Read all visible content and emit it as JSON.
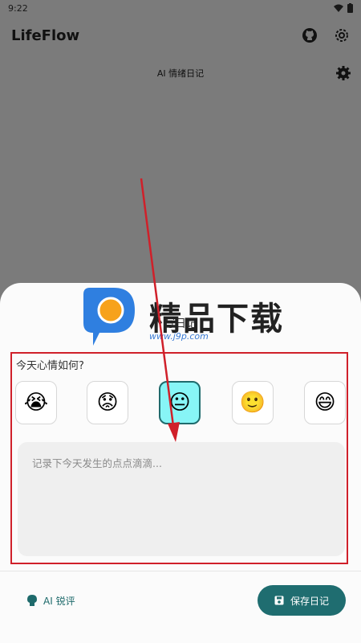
{
  "status": {
    "time": "9:22"
  },
  "app": {
    "title": "LifeFlow"
  },
  "diary_page": {
    "title": "AI 情绪日记"
  },
  "sheet": {
    "title": "写日记",
    "question": "今天心情如何?",
    "moods": [
      {
        "emoji": "😭",
        "selected": false
      },
      {
        "emoji": "😟",
        "selected": false
      },
      {
        "emoji": "😐",
        "selected": true
      },
      {
        "emoji": "🙂",
        "selected": false
      },
      {
        "emoji": "😄",
        "selected": false
      }
    ],
    "placeholder": "记录下今天发生的点点滴滴...",
    "ai_label": "AI 锐评",
    "save_label": "保存日记"
  },
  "watermark": {
    "name": "精品下载",
    "url": "www.j9p.com"
  },
  "colors": {
    "accent": "#1f6d70",
    "selected_bg": "#87f5f6",
    "frame": "#d0202a"
  }
}
